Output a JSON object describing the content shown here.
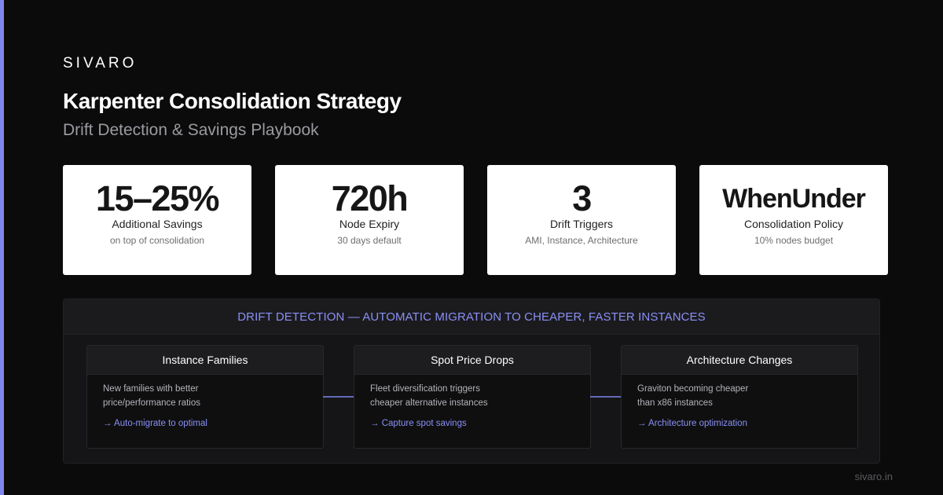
{
  "brand": "SIVARO",
  "title": "Karpenter Consolidation Strategy",
  "subtitle": "Drift Detection & Savings Playbook",
  "stats": [
    {
      "value": "15–25%",
      "label": "Additional Savings",
      "note": "on top of consolidation"
    },
    {
      "value": "720h",
      "label": "Node Expiry",
      "note": "30 days default"
    },
    {
      "value": "3",
      "label": "Drift Triggers",
      "note": "AMI, Instance, Architecture"
    },
    {
      "value": "WhenUnder",
      "label": "Consolidation Policy",
      "note": "10% nodes budget"
    }
  ],
  "panel": {
    "header": "DRIFT DETECTION — AUTOMATIC MIGRATION TO CHEAPER, FASTER INSTANCES",
    "cards": [
      {
        "title": "Instance Families",
        "line1": "New families with better",
        "line2": "price/performance ratios",
        "link": "→ Auto-migrate to optimal"
      },
      {
        "title": "Spot Price Drops",
        "line1": "Fleet diversification triggers",
        "line2": "cheaper alternative instances",
        "link": "→ Capture spot savings"
      },
      {
        "title": "Architecture Changes",
        "line1": "Graviton becoming cheaper",
        "line2": "than x86 instances",
        "link": "→ Architecture optimization"
      }
    ]
  },
  "footer": "sivaro.in",
  "colors": {
    "accent": "#7f86ee",
    "background": "#0b0b0b",
    "card": "#ffffff"
  }
}
